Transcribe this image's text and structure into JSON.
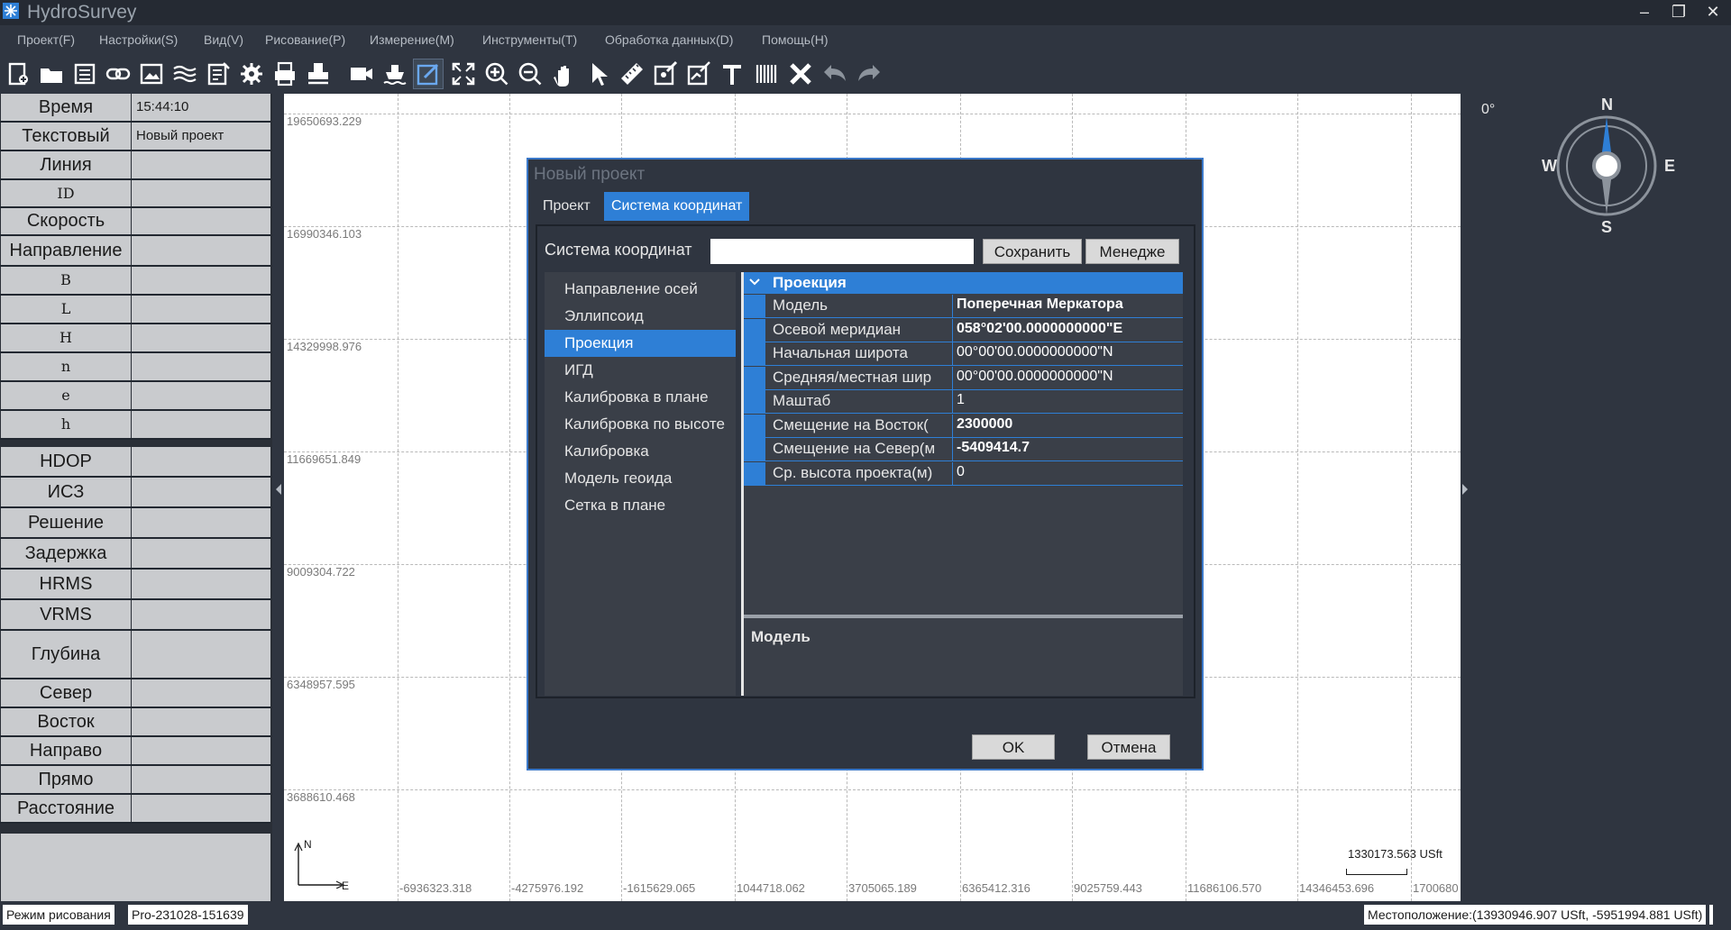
{
  "window": {
    "title": "HydroSurvey",
    "controls": [
      "–",
      "❐",
      "✕"
    ]
  },
  "menu": [
    "Проект(F)",
    "Настройки(S)",
    "Вид(V)",
    "Рисование(P)",
    "Измерение(M)",
    "Инструменты(T)",
    "Обработка данных(D)",
    "Помощь(H)"
  ],
  "toolbar_icons": [
    "new-project-icon",
    "open-folder-icon",
    "save-icon",
    "link-icon",
    "image-icon",
    "layers-icon",
    "export-icon",
    "gear-icon",
    "print-icon",
    "stamp-icon",
    "camera-icon",
    "ship-icon",
    "edit-icon",
    "fit-extent-icon",
    "zoom-in-icon",
    "zoom-out-icon",
    "pan-hand-icon",
    "select-arrow-icon",
    "ruler-icon",
    "edit-point-icon",
    "edit-line-icon",
    "text-icon",
    "barcode-icon",
    "delete-icon",
    "undo-icon",
    "redo-icon"
  ],
  "left_panel": [
    {
      "label": "Время",
      "value": "15:44:10"
    },
    {
      "label": "Текстовый",
      "value": "Новый проект"
    },
    {
      "label": "Линия",
      "value": ""
    },
    {
      "label": "ID",
      "value": ""
    },
    {
      "label": "Скорость",
      "value": ""
    },
    {
      "label": "Направление",
      "value": ""
    },
    {
      "label": "B",
      "value": ""
    },
    {
      "label": "L",
      "value": ""
    },
    {
      "label": "H",
      "value": ""
    },
    {
      "label": "n",
      "value": ""
    },
    {
      "label": "e",
      "value": ""
    },
    {
      "label": "h",
      "value": ""
    },
    {
      "label": "HDOP",
      "value": ""
    },
    {
      "label": "ИСЗ",
      "value": ""
    },
    {
      "label": "Решение",
      "value": ""
    },
    {
      "label": "Задержка",
      "value": ""
    },
    {
      "label": "HRMS",
      "value": ""
    },
    {
      "label": "VRMS",
      "value": ""
    },
    {
      "label": "Глубина",
      "value": ""
    },
    {
      "label": "Север",
      "value": ""
    },
    {
      "label": "Восток",
      "value": ""
    },
    {
      "label": "Направо",
      "value": ""
    },
    {
      "label": "Прямо",
      "value": ""
    },
    {
      "label": "Расстояние",
      "value": ""
    }
  ],
  "map": {
    "y_labels": [
      "19650693.229",
      "16990346.103",
      "14329998.976",
      "11669651.849",
      "9009304.722",
      "6348957.595",
      "3688610.468"
    ],
    "x_labels": [
      "-6936323.318",
      "-4275976.192",
      "-1615629.065",
      "1044718.062",
      "3705065.189",
      "6365412.316",
      "9025759.443",
      "11686106.570",
      "14346453.696",
      "1700680"
    ],
    "axis_n": "N",
    "axis_e": "E",
    "scale_text": "1330173.563 USft"
  },
  "compass": {
    "degree": "0°",
    "n": "N",
    "e": "E",
    "s": "S",
    "w": "W"
  },
  "dialog": {
    "title": "Новый проект",
    "tabs": [
      "Проект",
      "Система координат"
    ],
    "cs_label": "Система координат",
    "cs_value": "",
    "save_button": "Сохранить",
    "manager_button": "Менедже",
    "categories": [
      "Направление осей",
      "Эллипсоид",
      "Проекция",
      "ИГД",
      "Калибровка в плане",
      "Калибровка по высоте",
      "Калибровка",
      "Модель геоида",
      "Сетка в плане"
    ],
    "selected_category": "Проекция",
    "group": "Проекция",
    "properties": [
      {
        "name": "Модель",
        "value": "Поперечная Меркатора",
        "bold": true
      },
      {
        "name": "Осевой меридиан",
        "value": "058°02'00.0000000000\"E",
        "bold": true
      },
      {
        "name": "Начальная широта",
        "value": "00°00'00.0000000000\"N",
        "bold": false
      },
      {
        "name": "Средняя/местная шир",
        "value": "00°00'00.0000000000\"N",
        "bold": false
      },
      {
        "name": "Маштаб",
        "value": "1",
        "bold": false
      },
      {
        "name": "Смещение на Восток(",
        "value": "2300000",
        "bold": true
      },
      {
        "name": "Смещение на Север(м",
        "value": "-5409414.7",
        "bold": true
      },
      {
        "name": "Ср. высота проекта(м)",
        "value": "0",
        "bold": false
      }
    ],
    "description_title": "Модель",
    "ok_button": "OK",
    "cancel_button": "Отмена"
  },
  "status": {
    "mode": "Режим рисования",
    "project": "Pro-231028-151639",
    "location": "Местоположение:(13930946.907 USft, -5951994.881 USft)"
  },
  "colors": {
    "accent": "#2e7fd6",
    "background": "#2f3540",
    "panel_label": "#c9cbce"
  }
}
